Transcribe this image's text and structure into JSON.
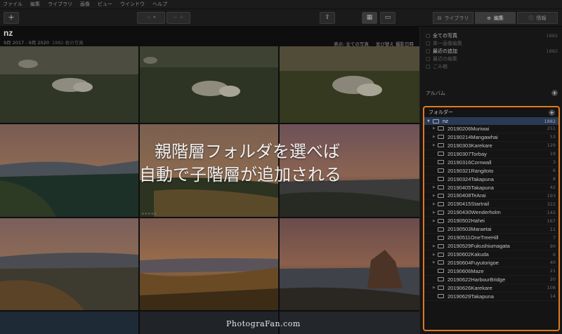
{
  "menu": [
    "ファイル",
    "編集",
    "ライブラリ",
    "画像",
    "ビュー",
    "ウインドウ",
    "ヘルプ"
  ],
  "toolbar": {
    "add_label": "+",
    "tabs": [
      {
        "label": "ライブラリ",
        "icon": "library-icon",
        "active": false
      },
      {
        "label": "編集",
        "icon": "sliders-icon",
        "active": true
      },
      {
        "label": "情報",
        "icon": "info-icon",
        "active": false
      }
    ]
  },
  "main": {
    "title": "nz",
    "date_range": "9月 2017 - 9月 2020",
    "photo_count": "1882 枚の写真",
    "display_label": "表示: 全ての写真",
    "sort_label": "並び替え 撮影日時"
  },
  "overlay": {
    "line1": "親階層フォルダを選べば",
    "line2": "自動で子階層が追加される"
  },
  "watermark": "PhotograFan.com",
  "library": [
    {
      "label": "全ての写真",
      "count": "1882",
      "icon": "photos-icon",
      "dim": false
    },
    {
      "label": "単一画像編集",
      "count": "",
      "icon": "single-edit-icon",
      "dim": true
    },
    {
      "label": "最近の追加",
      "count": "1882",
      "icon": "clock-icon",
      "dim": false
    },
    {
      "label": "最近の編集",
      "count": "",
      "icon": "recent-edit-icon",
      "dim": true
    },
    {
      "label": "ごみ箱",
      "count": "",
      "icon": "trash-icon",
      "dim": true
    }
  ],
  "album_label": "アルバム",
  "folders": {
    "header": "フォルダー",
    "root": {
      "name": "nz",
      "count": "1882"
    },
    "items": [
      {
        "name": "20190206Muriwai",
        "count": "251",
        "expandable": true
      },
      {
        "name": "20190214Mangawhai",
        "count": "53",
        "expandable": true
      },
      {
        "name": "20190303Karekare",
        "count": "129",
        "expandable": true
      },
      {
        "name": "20190307Torbay",
        "count": "19",
        "expandable": false
      },
      {
        "name": "20190316Cornwall",
        "count": "3",
        "expandable": false
      },
      {
        "name": "20190321Rangitoto",
        "count": "6",
        "expandable": false
      },
      {
        "name": "20190324Takapuna",
        "count": "8",
        "expandable": false
      },
      {
        "name": "20190405Takapuna",
        "count": "42",
        "expandable": true
      },
      {
        "name": "20190408TeArai",
        "count": "193",
        "expandable": true
      },
      {
        "name": "20190415Startrail",
        "count": "322",
        "expandable": true
      },
      {
        "name": "20190430Wenderholm",
        "count": "142",
        "expandable": true
      },
      {
        "name": "20190502Hahei",
        "count": "167",
        "expandable": true
      },
      {
        "name": "20190503Maraetai",
        "count": "11",
        "expandable": false
      },
      {
        "name": "20190511OneTreeHill",
        "count": "7",
        "expandable": false
      },
      {
        "name": "20190529Fukushiumagata",
        "count": "90",
        "expandable": true
      },
      {
        "name": "20190602Kakuda",
        "count": "6",
        "expandable": true
      },
      {
        "name": "20190604Fuyutorigoe",
        "count": "40",
        "expandable": true
      },
      {
        "name": "20190606Maze",
        "count": "21",
        "expandable": false
      },
      {
        "name": "20190622HarbourBridge",
        "count": "20",
        "expandable": false
      },
      {
        "name": "20190626Karekare",
        "count": "108",
        "expandable": true
      },
      {
        "name": "20190629Takapuna",
        "count": "14",
        "expandable": false
      }
    ]
  }
}
